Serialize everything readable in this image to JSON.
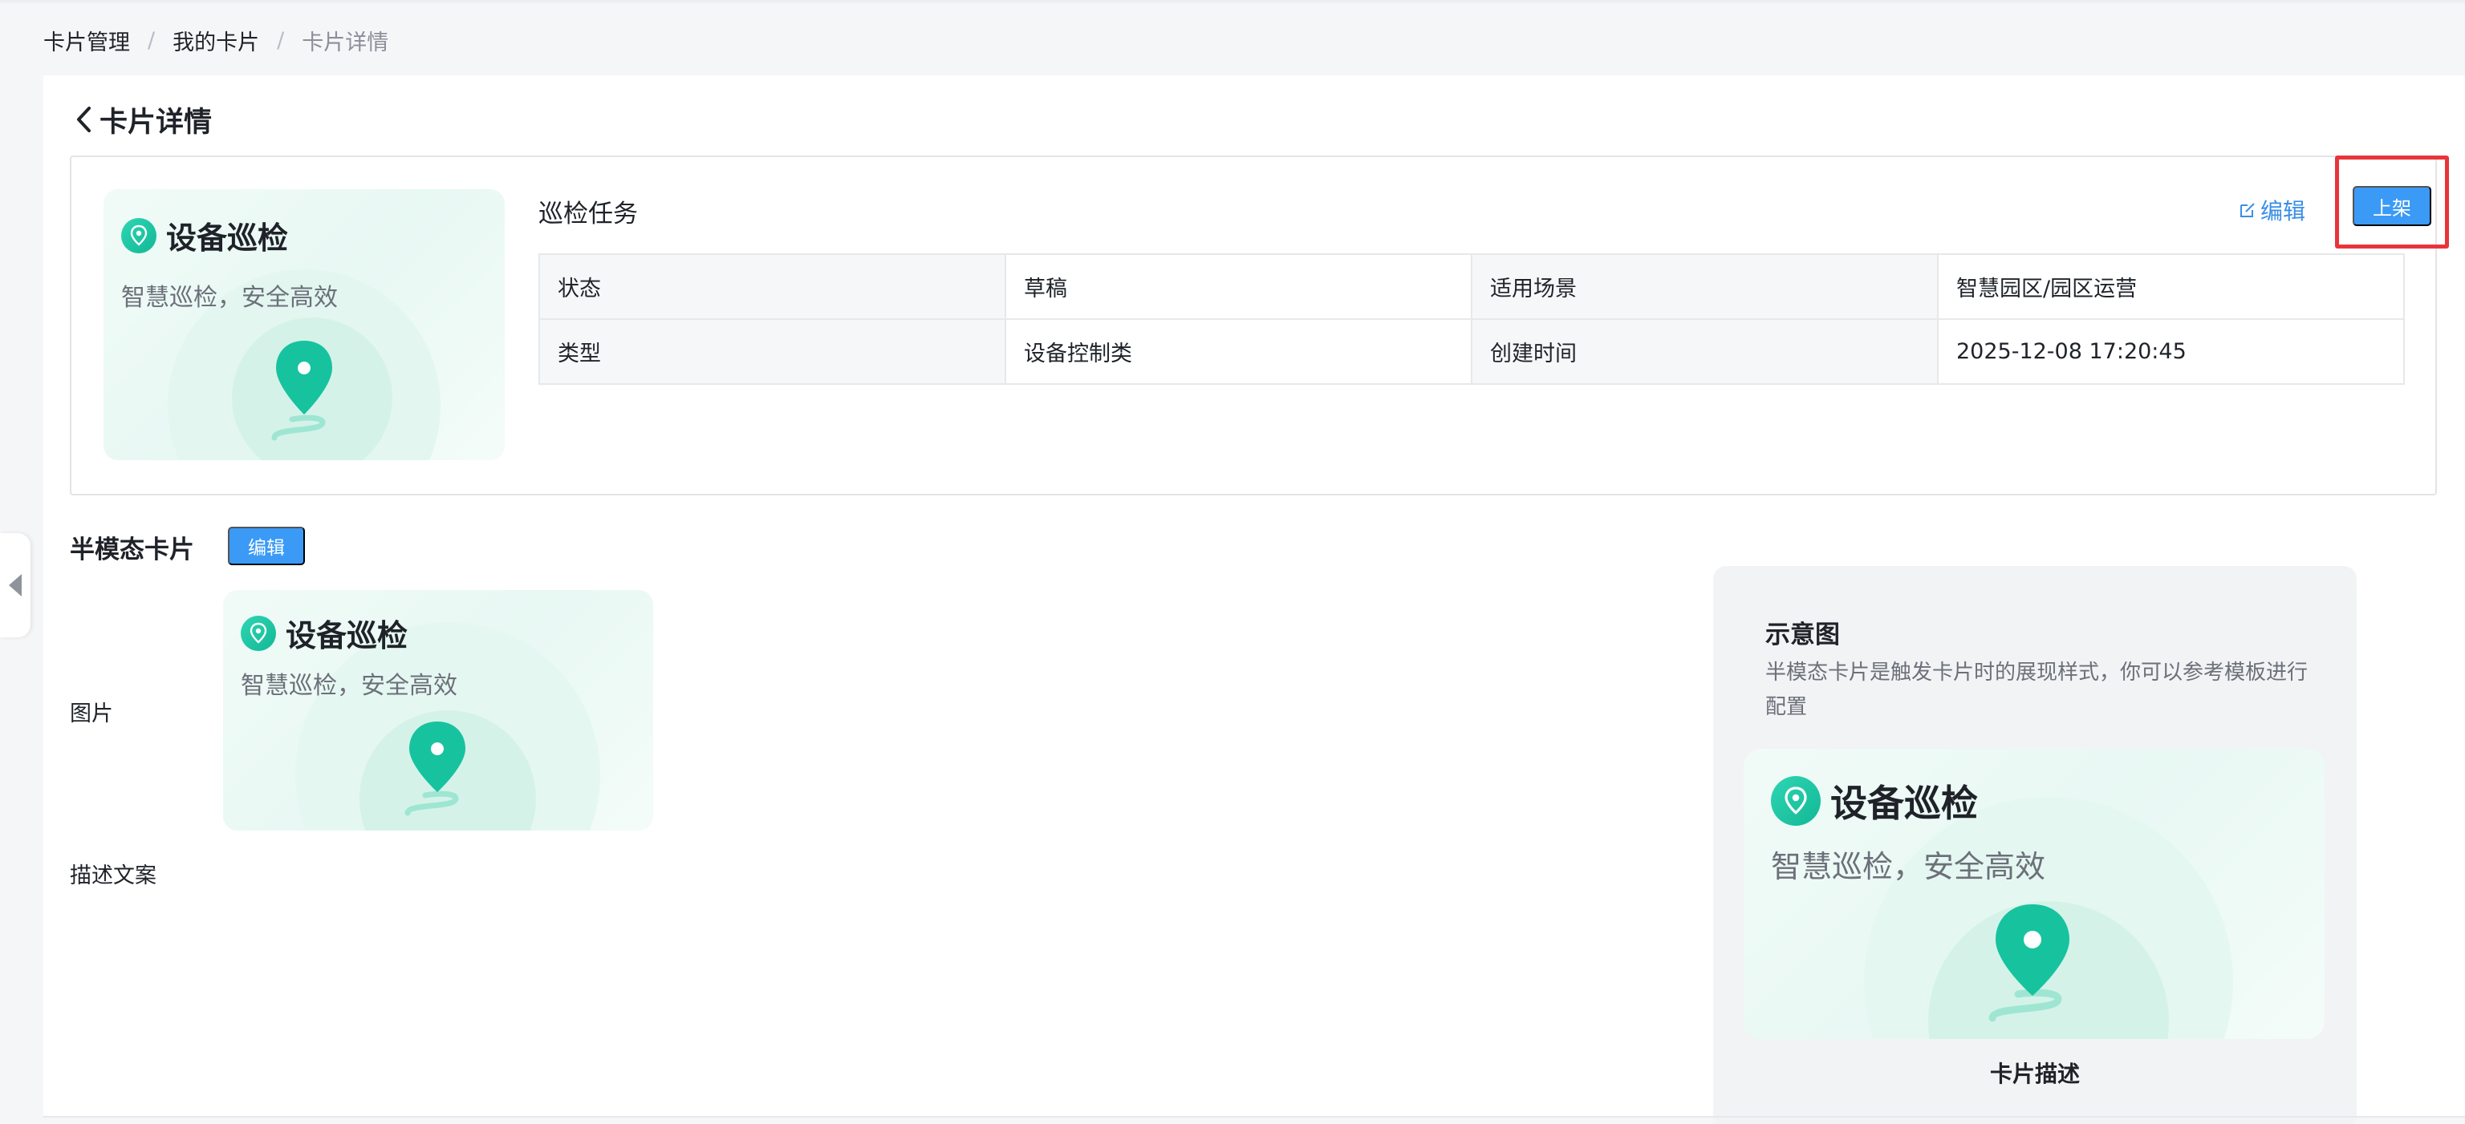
{
  "breadcrumb": [
    "卡片管理",
    "我的卡片",
    "卡片详情"
  ],
  "breadcrumb_separator": "/",
  "page": {
    "title": "卡片详情"
  },
  "card": {
    "name": "设备巡检",
    "slogan": "智慧巡检，安全高效",
    "accent_color": "#14bf9c"
  },
  "summary": {
    "title": "巡检任务",
    "edit_label": "编辑",
    "publish_label": "上架",
    "rows": [
      [
        {
          "label": "状态",
          "value": "草稿"
        },
        {
          "label": "适用场景",
          "value": "智慧园区/园区运营"
        }
      ],
      [
        {
          "label": "类型",
          "value": "设备控制类"
        },
        {
          "label": "创建时间",
          "value": "2025-12-08 17:20:45"
        }
      ]
    ]
  },
  "semi_modal": {
    "title": "半模态卡片",
    "edit_label": "编辑",
    "image_label": "图片",
    "desc_label": "描述文案"
  },
  "schematic": {
    "title": "示意图",
    "description": "半模态卡片是触发卡片时的展现样式，你可以参考模板进行配置",
    "caption": "卡片描述"
  },
  "colors": {
    "primary_button": "#3a9af6",
    "link": "#3a8ee6",
    "highlight_border": "#e7353b"
  }
}
